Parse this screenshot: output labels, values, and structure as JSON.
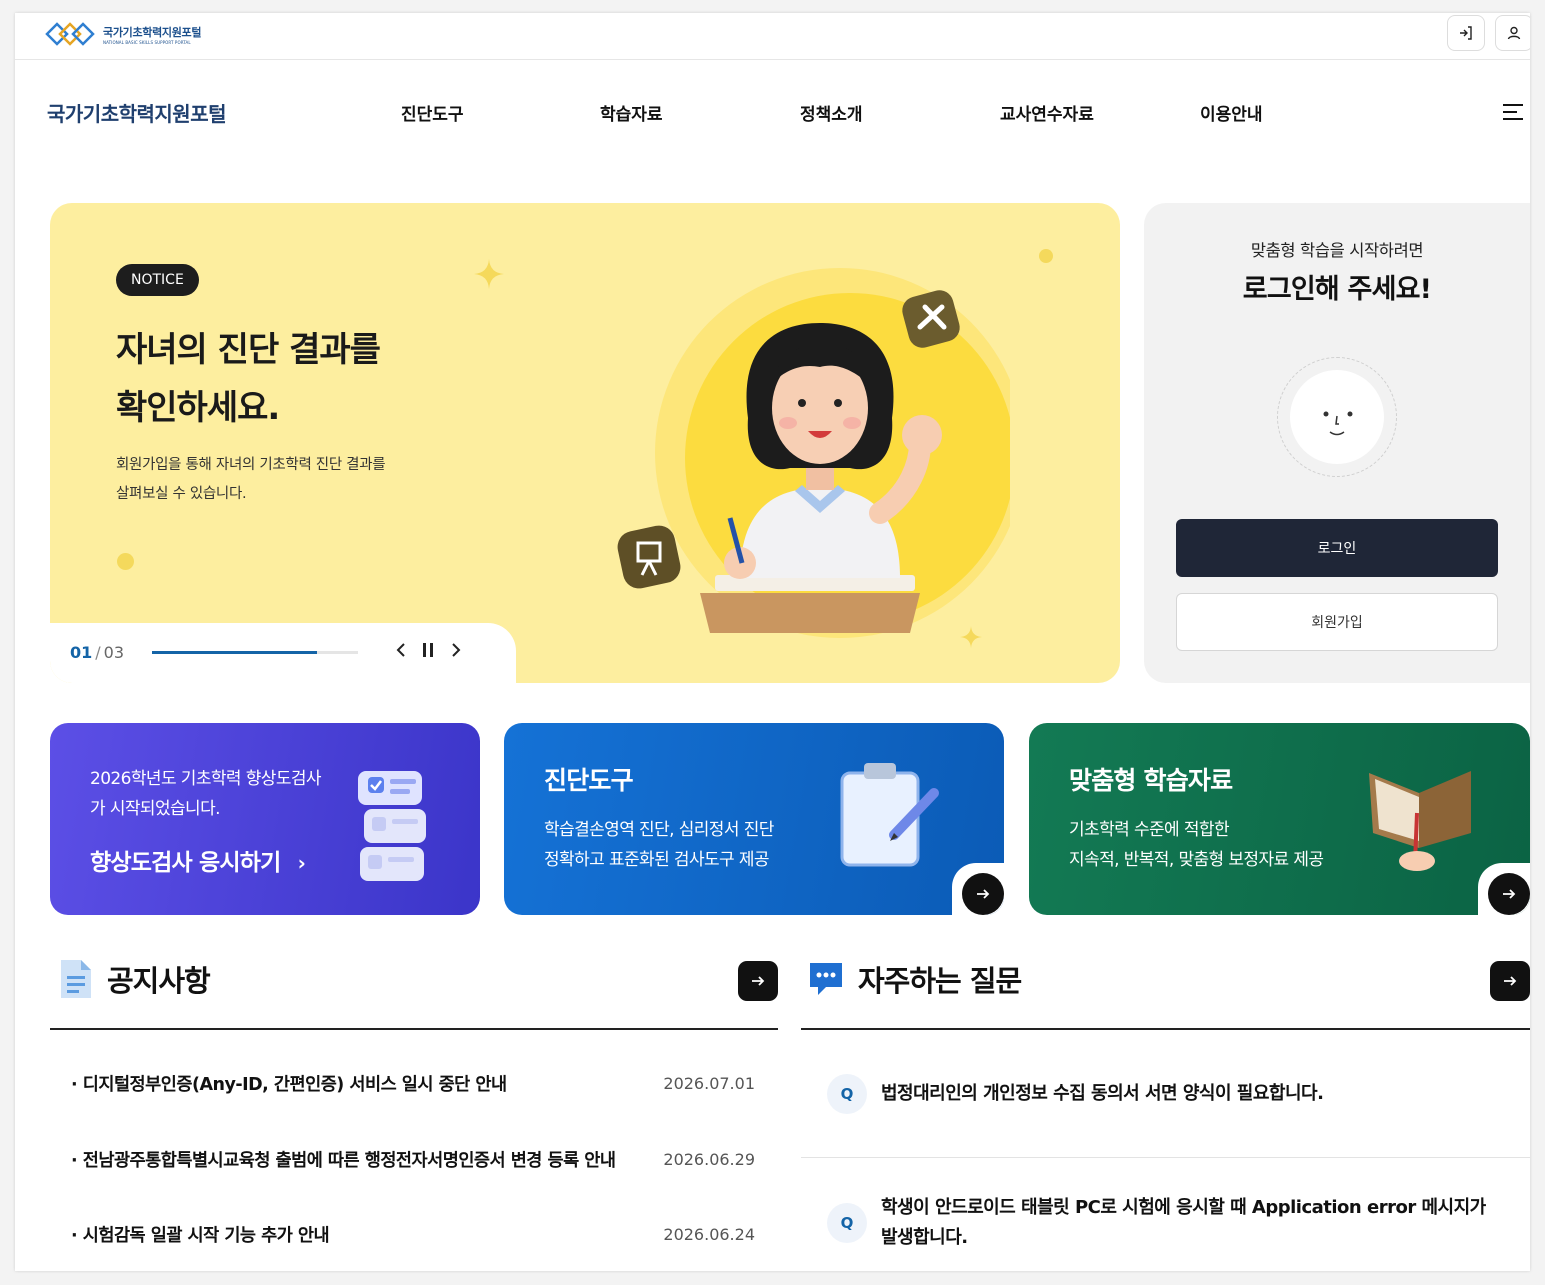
{
  "utility": {
    "logo_ko": "국가기초학력지원포털",
    "logo_en": "NATIONAL BASIC SKILLS SUPPORT PORTAL"
  },
  "header": {
    "site_title": "국가기초학력지원포털",
    "nav": [
      "진단도구",
      "학습자료",
      "정책소개",
      "교사연수자료",
      "이용안내"
    ]
  },
  "hero": {
    "badge": "NOTICE",
    "title_line1": "자녀의 진단 결과를",
    "title_line2": "확인하세요.",
    "desc_line1": "회원가입을 통해 자녀의 기초학력 진단 결과를",
    "desc_line2": "살펴보실 수 있습니다.",
    "pager_current": "01",
    "pager_sep": "/",
    "pager_total": "03",
    "progress": 0.8
  },
  "login": {
    "subtitle": "맞춤형 학습을 시작하려면",
    "title": "로그인해 주세요!",
    "login_label": "로그인",
    "signup_label": "회원가입"
  },
  "cards": {
    "c1_line1": "2026학년도 기초학력 향상도검사",
    "c1_line2": "가 시작되었습니다.",
    "c1_link": "향상도검사 응시하기",
    "c2_title": "진단도구",
    "c2_line1": "학습결손영역 진단, 심리정서 진단",
    "c2_line2": "정확하고 표준화된 검사도구 제공",
    "c3_title": "맞춤형 학습자료",
    "c3_line1": "기초학력 수준에 적합한",
    "c3_line2": "지속적, 반복적, 맞춤형 보정자료 제공"
  },
  "notice_board": {
    "title": "공지사항",
    "items": [
      {
        "text": "· 디지털정부인증(Any-ID, 간편인증) 서비스 일시 중단 안내",
        "date": "2026.07.01"
      },
      {
        "text": "· 전남광주통합특별시교육청 출범에 따른 행정전자서명인증서 변경 등록 안내",
        "date": "2026.06.29"
      },
      {
        "text": "· 시험감독 일괄 시작 기능 추가 안내",
        "date": "2026.06.24"
      }
    ]
  },
  "faq_board": {
    "title": "자주하는 질문",
    "q_label": "Q",
    "items": [
      {
        "line1": "법정대리인의 개인정보 수집 동의서 서면 양식이 필요합니다.",
        "line2": ""
      },
      {
        "line1": "학생이 안드로이드 태블릿 PC로 시험에 응시할 때 Application error 메시지가",
        "line2": "발생합니다."
      }
    ]
  },
  "colors": {
    "accent": "#1464a7",
    "hero_bg": "#fdee9f",
    "card1": "#4b42d8",
    "card2": "#1168c8",
    "card3": "#0f6e4c"
  }
}
